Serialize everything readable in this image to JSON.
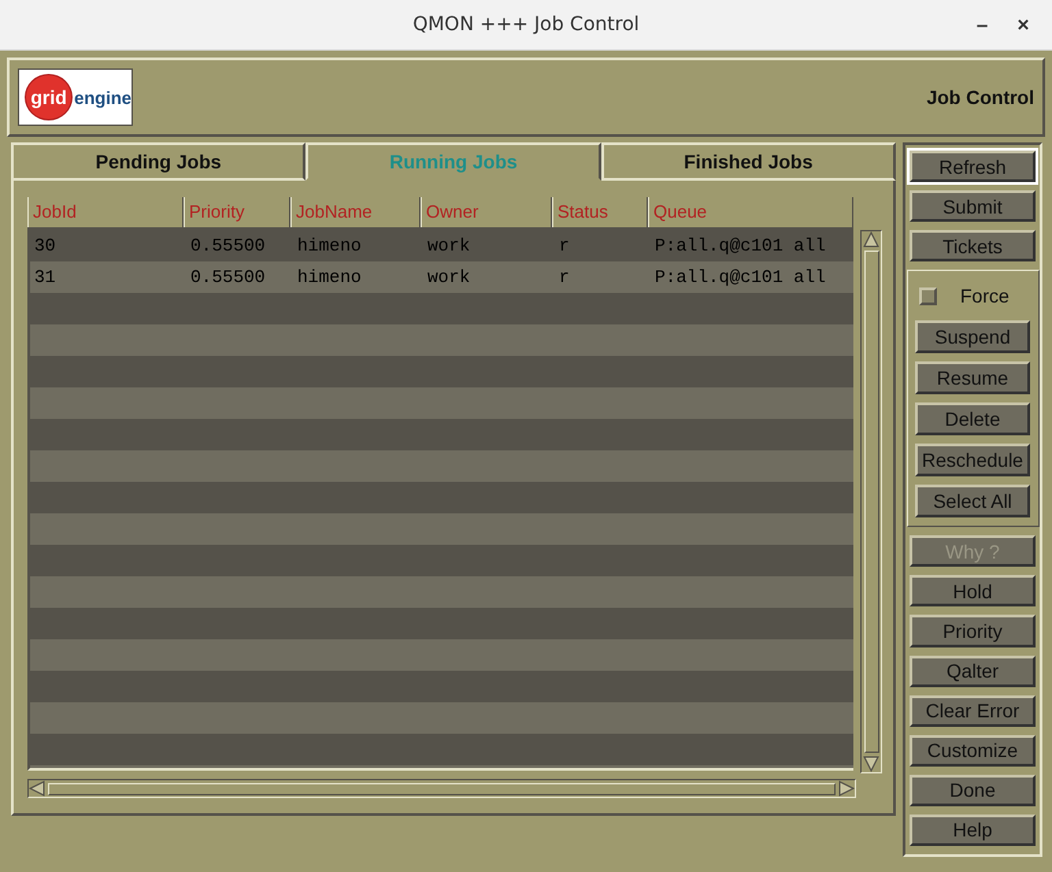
{
  "window": {
    "title": "QMON +++ Job Control",
    "controls": [
      "–",
      "×"
    ]
  },
  "header": {
    "logo": {
      "word_1": "grid",
      "word_2": "engine"
    },
    "title": "Job Control"
  },
  "tabs": [
    {
      "label": "Pending Jobs",
      "selected": false
    },
    {
      "label": "Running Jobs",
      "selected": true
    },
    {
      "label": "Finished Jobs",
      "selected": false
    }
  ],
  "table": {
    "columns": [
      "JobId",
      "Priority",
      "JobName",
      "Owner",
      "Status",
      "Queue"
    ],
    "rows": [
      [
        "30",
        "0.55500",
        "himeno",
        "work",
        "r",
        "P:all.q@c101 all"
      ],
      [
        "31",
        "0.55500",
        "himeno",
        "work",
        "r",
        "P:all.q@c101 all"
      ]
    ]
  },
  "buttons_top": [
    {
      "label": "Refresh",
      "focused": true,
      "disabled": false
    },
    {
      "label": "Submit",
      "focused": false,
      "disabled": false
    },
    {
      "label": "Tickets",
      "focused": false,
      "disabled": false
    }
  ],
  "action_group": {
    "force": {
      "label": "Force",
      "checked": false
    },
    "buttons": [
      {
        "label": "Suspend",
        "disabled": false
      },
      {
        "label": "Resume",
        "disabled": false
      },
      {
        "label": "Delete",
        "disabled": false
      },
      {
        "label": "Reschedule",
        "disabled": false
      },
      {
        "label": "Select All",
        "disabled": false
      }
    ]
  },
  "buttons_bottom": [
    {
      "label": "Why ?",
      "disabled": true
    },
    {
      "label": "Hold",
      "disabled": false
    },
    {
      "label": "Priority",
      "disabled": false
    },
    {
      "label": "Qalter",
      "disabled": false
    },
    {
      "label": "Clear Error",
      "disabled": false
    },
    {
      "label": "Customize",
      "disabled": false
    },
    {
      "label": "Done",
      "disabled": false
    },
    {
      "label": "Help",
      "disabled": false
    }
  ]
}
